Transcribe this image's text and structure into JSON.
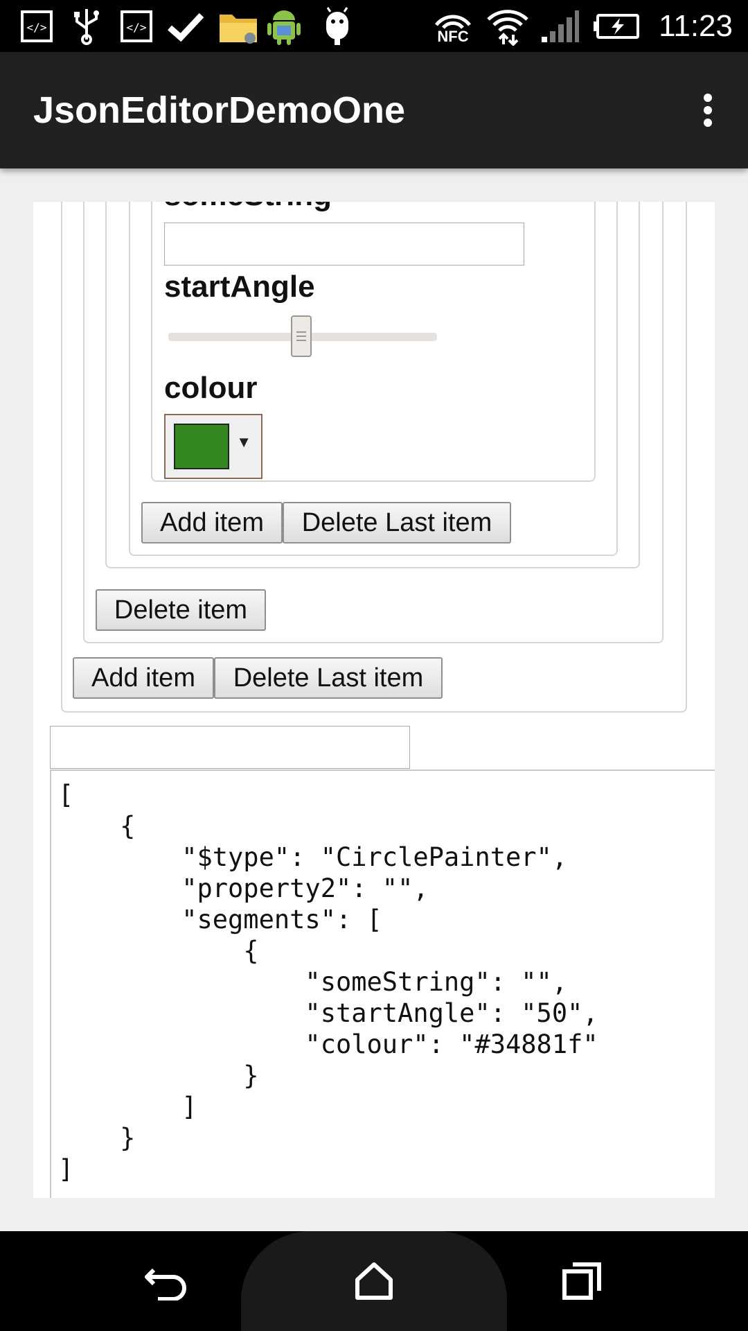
{
  "status_bar": {
    "time": "11:23",
    "nfc_label": "NFC",
    "left_icons": [
      "code-icon",
      "usb-icon",
      "code-icon",
      "check-icon",
      "folder-icon",
      "android-icon",
      "android-head-icon"
    ]
  },
  "app_bar": {
    "title": "JsonEditorDemoOne",
    "overflow_icon": "more-vert-icon"
  },
  "form": {
    "some_string_label": "someString",
    "some_string_value": "",
    "start_angle_label": "startAngle",
    "start_angle_value": 50,
    "colour_label": "colour",
    "colour_value": "#34881f",
    "inner_add_label": "Add item",
    "inner_delete_last_label": "Delete Last item",
    "delete_item_label": "Delete item",
    "outer_add_label": "Add item",
    "outer_delete_last_label": "Delete Last item",
    "bottom_input_value": ""
  },
  "json_output": {
    "lines": [
      "[",
      "    {",
      "        \"$type\": \"CirclePainter\",",
      "        \"property2\": \"\",",
      "        \"segments\": [",
      "            {",
      "                \"someString\": \"\",",
      "                \"startAngle\": \"50\",",
      "                \"colour\": \"#34881f\"",
      "            }",
      "        ]",
      "    }",
      "]"
    ]
  },
  "nav_bar": {
    "back_icon": "back-icon",
    "home_icon": "home-icon",
    "recents_icon": "recents-icon"
  }
}
